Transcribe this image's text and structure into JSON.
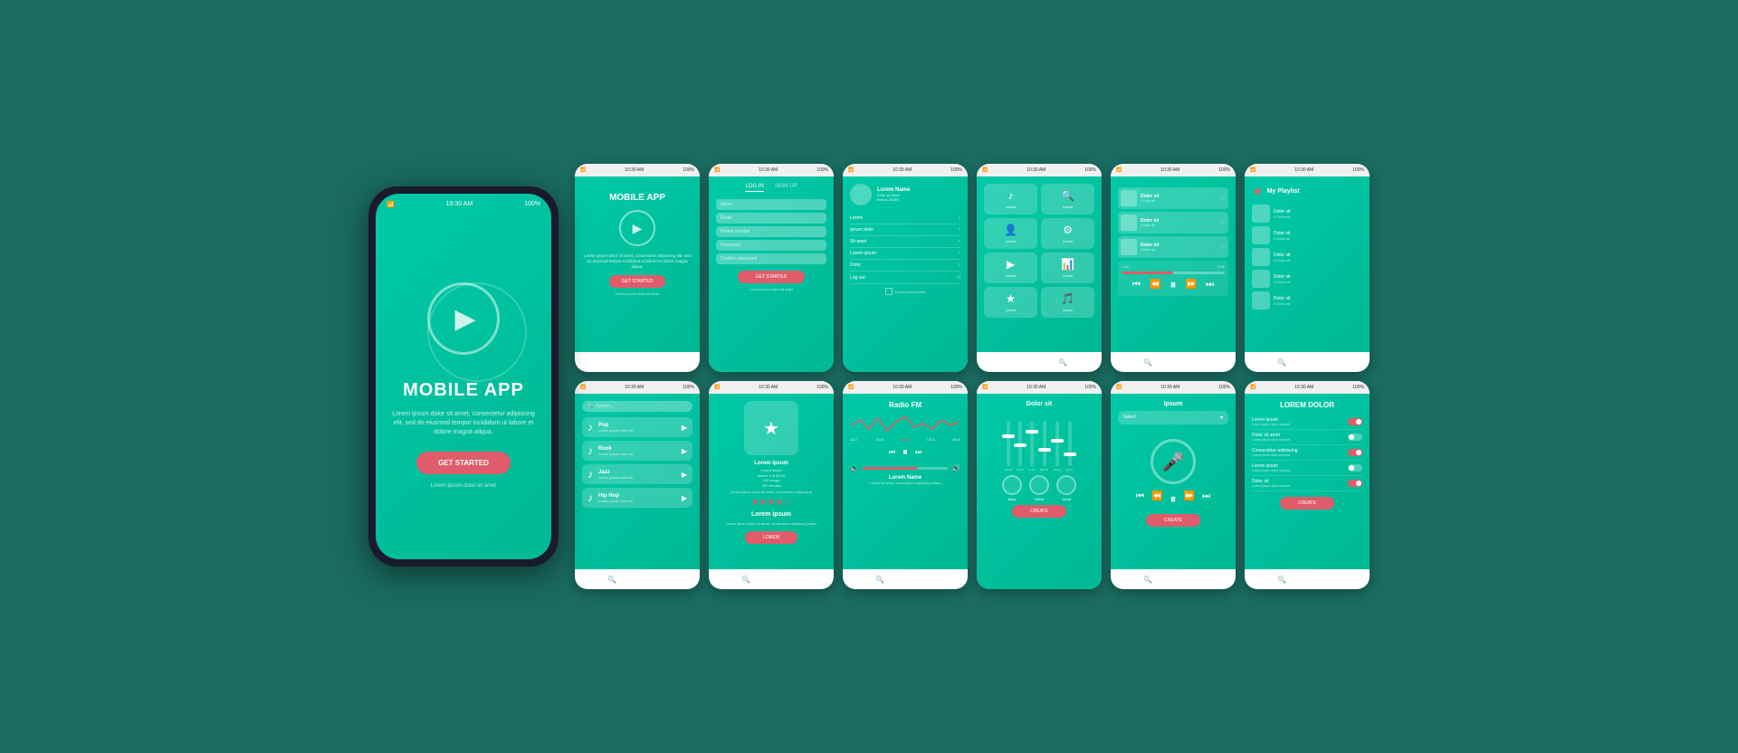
{
  "app": {
    "title": "MOBILE APP",
    "status_time": "10:30 AM",
    "status_battery": "100%",
    "description": "Lorem ipsum dolor sit amet, consectetur adipiscing elit, sed do eiusmod tempor incididunt ut labore et dolore magna aliqua.",
    "get_started": "GET STARTED",
    "bottom_text": "Lorem ipsum dolor sit amet"
  },
  "screens": {
    "splash": {
      "title": "MOBILE APP",
      "desc": "Lorem ipsum dolor sit amet, consectetur adipiscing elit, sed do eiusmod tempor incididunt ut labore et dolore magna aliqua.",
      "btn": "GET STARTED",
      "sub": "Lorem ipsum dolor sit amet"
    },
    "login": {
      "tab_login": "LOG IN",
      "tab_signup": "SIGN UP",
      "name_placeholder": "Name",
      "email_placeholder": "Email",
      "phone_placeholder": "Phone number",
      "password_placeholder": "Password",
      "confirm_placeholder": "Confirm password",
      "btn": "GET STARTED",
      "sub": "Lorem ipsum dolor sit amet"
    },
    "auth": {
      "tab_login": "LOG IN",
      "tab_signup": "SIGN UP",
      "btn": "LOG IN"
    },
    "profile": {
      "name": "Lorem Name",
      "location": "Dolor sit amet",
      "bonus": "Bonus 25489",
      "menu": [
        "Lorem",
        "Ipsum dolor",
        "Sit amet",
        "Lorem ipsum",
        "Dolor",
        "Log out"
      ]
    },
    "music_list": {
      "search": "Search...",
      "genres": [
        {
          "name": "Pop",
          "sub": "Lorem ipsum dolor sit"
        },
        {
          "name": "Rock",
          "sub": "Lorem ipsum dolor sit"
        },
        {
          "name": "Jazz",
          "sub": "Lorem ipsum dolor sit"
        },
        {
          "name": "Hip Hop",
          "sub": "Lorem ipsum dolor sit"
        }
      ]
    },
    "now_playing": {
      "title": "Lorem ipsum",
      "sub": "Lorem ipsum\nMarch 1 at 00:00\n100 songs\n765 minutes",
      "rating": "★★★★☆",
      "desc": "Lorem ipsum",
      "btn": "LOREM"
    },
    "radio": {
      "title": "Radio FM",
      "frequencies": [
        "101.7",
        "101.8",
        "102.8",
        "103.6",
        "104.6"
      ],
      "artist": "Lorem Name",
      "sub": "Lorem sit amet, consectetur adipiscing sitam"
    },
    "eq": {
      "title": "Dolor sit",
      "labels": [
        "60 Hz",
        "30 Hz",
        "14 Hz",
        "230 Hz",
        "140 Hz",
        "40 Hz"
      ],
      "bass": "Bass",
      "treble": "Treble",
      "vocal": "Vocal",
      "btn": "CREATE"
    },
    "voice": {
      "title": "Ipsum",
      "btn": "CREATE"
    },
    "playlist": {
      "title": "My Playlist",
      "songs": [
        "Dolor sit",
        "Dolor sit",
        "Dolor sit",
        "Dolor sit",
        "Dolor sit"
      ],
      "sub": "4 Dolor sit"
    },
    "settings": {
      "title": "LOREM DOLOR",
      "items": [
        "Lorem ipsum",
        "Dolor sit amet",
        "Consectetur adipiscing",
        "Lorem ipsum",
        "Dolor sit"
      ],
      "btn": "CREATE"
    },
    "player": {
      "title": "Dolor sit",
      "sub": "4 Dolor sit",
      "time_start": "1:20",
      "time_end": "2:40"
    }
  },
  "nav": {
    "icons": [
      "♥",
      "♪",
      "☰",
      "★",
      "⚙"
    ]
  },
  "colors": {
    "teal": "#00b894",
    "teal_dark": "#1a6b60",
    "coral": "#e05c6a",
    "white": "#ffffff"
  }
}
